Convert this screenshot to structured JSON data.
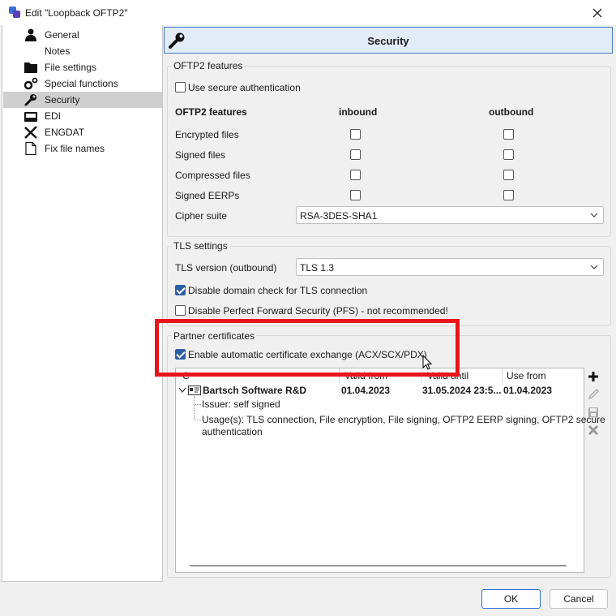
{
  "window": {
    "title": "Edit \"Loopback OFTP2\""
  },
  "nav": {
    "items": [
      {
        "label": "General",
        "icon": "person-icon"
      },
      {
        "label": "Notes",
        "icon": "blank-icon"
      },
      {
        "label": "File settings",
        "icon": "folder-icon"
      },
      {
        "label": "Special functions",
        "icon": "gears-icon"
      },
      {
        "label": "Security",
        "icon": "wrench-icon",
        "selected": true
      },
      {
        "label": "EDI",
        "icon": "inbox-tray-icon"
      },
      {
        "label": "ENGDAT",
        "icon": "tools-icon"
      },
      {
        "label": "Fix file names",
        "icon": "document-icon"
      }
    ]
  },
  "header": {
    "title": "Security"
  },
  "oftp2": {
    "group_label": "OFTP2 features",
    "secure_auth_label": "Use secure authentication",
    "secure_auth_checked": false,
    "col_feature": "OFTP2 features",
    "col_inbound": "inbound",
    "col_outbound": "outbound",
    "rows": [
      {
        "label": "Encrypted files",
        "inbound": false,
        "outbound": false
      },
      {
        "label": "Signed files",
        "inbound": false,
        "outbound": false
      },
      {
        "label": "Compressed files",
        "inbound": false,
        "outbound": false
      },
      {
        "label": "Signed EERPs",
        "inbound": false,
        "outbound": false
      }
    ],
    "cipher_label": "Cipher suite",
    "cipher_value": "RSA-3DES-SHA1"
  },
  "tls": {
    "group_label": "TLS settings",
    "version_label": "TLS version (outbound)",
    "version_value": "TLS 1.3",
    "domain_check_label": "Disable domain check for TLS connection",
    "domain_check_checked": true,
    "pfs_label": "Disable Perfect Forward Security (PFS) - not recommended!",
    "pfs_checked": false
  },
  "partner": {
    "group_label": "Partner certificates",
    "auto_exchange_label": "Enable automatic certificate exchange (ACX/SCX/PDX)",
    "auto_exchange_checked": true,
    "columns": {
      "name": "C",
      "valid_from": "Valid from",
      "valid_until": "Valid until",
      "use_from": "Use from"
    },
    "certificate": {
      "name": "Bartsch Software R&D",
      "valid_from": "01.04.2023",
      "valid_until": "31.05.2024 23:5...",
      "use_from": "01.04.2023",
      "issuer": "Issuer: self signed",
      "usage_line1": "Usage(s): TLS connection, File encryption, File signing, OFTP2 EERP signing, OFTP2 secure",
      "usage_line2": "authentication"
    }
  },
  "buttons": {
    "ok": "OK",
    "cancel": "Cancel"
  },
  "colors": {
    "accent": "#2d5fa6",
    "highlight": "#e8141c",
    "header_bg": "#e1ecf8",
    "selected_nav": "#cfcfcf"
  }
}
